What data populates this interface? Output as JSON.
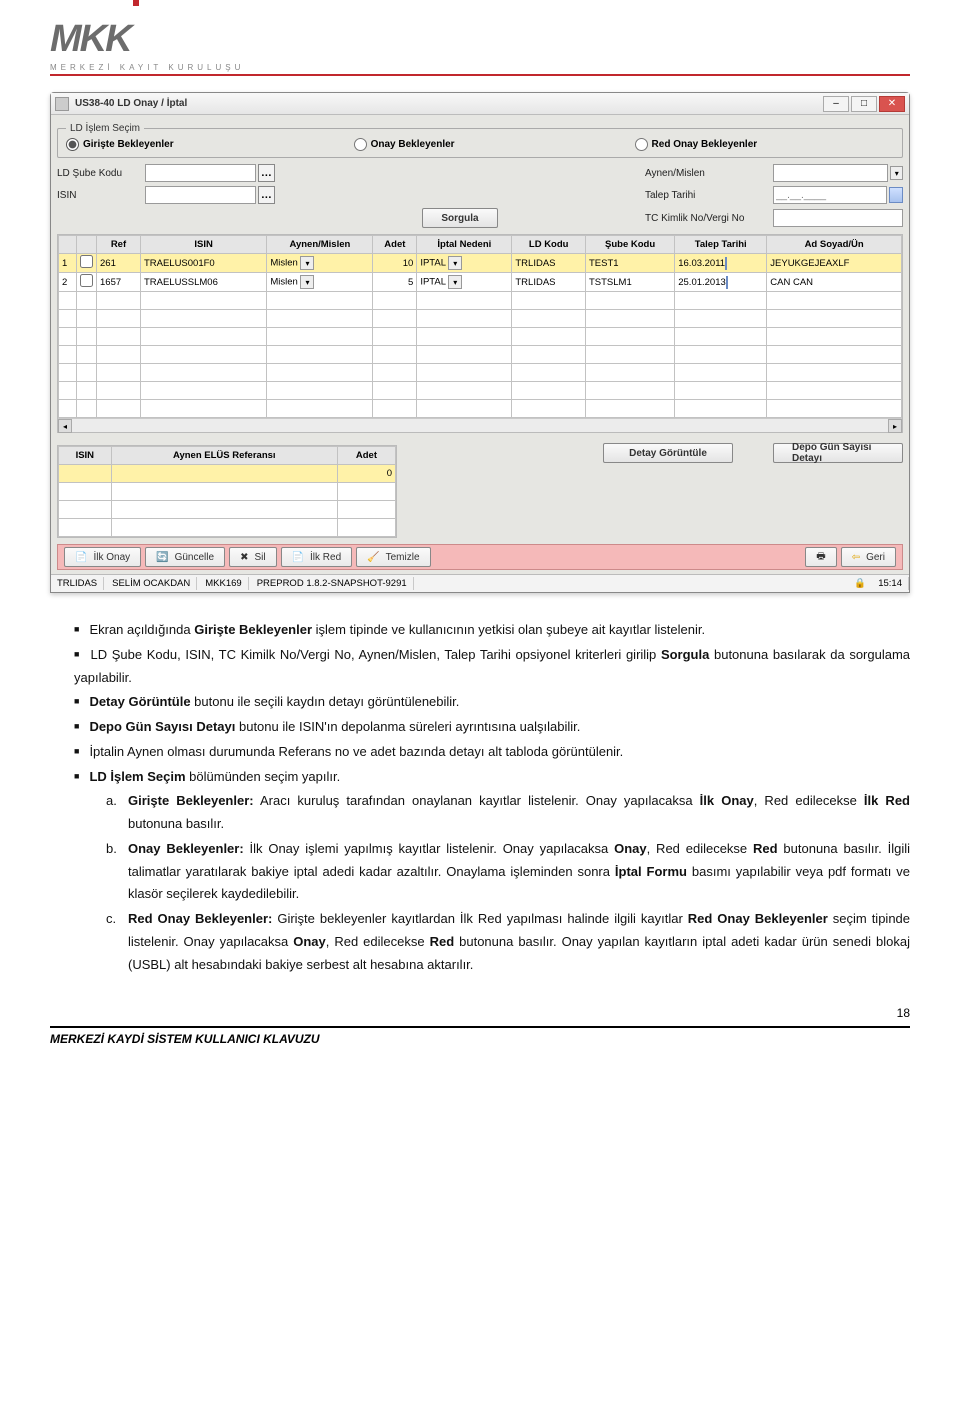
{
  "logo": {
    "letters": "MKK",
    "tagline": "MERKEZİ KAYIT KURULUŞU"
  },
  "window": {
    "title": "US38-40 LD Onay / İptal",
    "group_legend": "LD İşlem Seçim",
    "radios": {
      "giriste": "Girişte Bekleyenler",
      "onay": "Onay Bekleyenler",
      "redonay": "Red Onay Bekleyenler"
    },
    "labels": {
      "ld_sube": "LD Şube Kodu",
      "isin": "ISIN",
      "aynen": "Aynen/Mislen",
      "talep": "Talep Tarihi",
      "tc": "TC Kimlik No/Vergi No",
      "sorgula": "Sorgula",
      "talep_placeholder": "__.__.____"
    },
    "table1": {
      "headers": [
        "#",
        "",
        "Ref",
        "ISIN",
        "Aynen/Mislen",
        "Adet",
        "İptal Nedeni",
        "LD Kodu",
        "Şube Kodu",
        "Talep Tarihi",
        "Ad Soyad/Ün"
      ],
      "rows": [
        {
          "n": "1",
          "ref": "261",
          "isin": "TRAELUS001F0",
          "am": "Mislen",
          "adet": "10",
          "iptal": "IPTAL",
          "ld": "TRLIDAS",
          "sube": "TEST1",
          "tarih": "16.03.2011",
          "ad": "JEYUKGEJEAXLF",
          "hl": true
        },
        {
          "n": "2",
          "ref": "1657",
          "isin": "TRAELUSSLM06",
          "am": "Mislen",
          "adet": "5",
          "iptal": "IPTAL",
          "ld": "TRLIDAS",
          "sube": "TSTSLM1",
          "tarih": "25.01.2013",
          "ad": "CAN CAN",
          "hl": false
        }
      ]
    },
    "table2": {
      "headers": [
        "ISIN",
        "Aynen ELÜS Referansı",
        "Adet"
      ],
      "row_adet": "0"
    },
    "buttons": {
      "detay": "Detay Görüntüle",
      "depo": "Depo Gün Sayısı Detayı",
      "ilk_onay": "İlk Onay",
      "guncelle": "Güncelle",
      "sil": "Sil",
      "ilk_red": "İlk Red",
      "temizle": "Temizle",
      "geri": "Geri"
    },
    "status": {
      "s1": "TRLIDAS",
      "s2": "SELİM OCAKDAN",
      "s3": "MKK169",
      "s4": "PREPROD 1.8.2-SNAPSHOT-9291",
      "time": "15:14"
    }
  },
  "doc": {
    "b1_a": "Ekran açıldığında ",
    "b1_b": "Girişte Bekleyenler",
    "b1_c": " işlem tipinde ve kullanıcının yetkisi olan şubeye ait kayıtlar listelenir.",
    "b2_a": "LD Şube Kodu, ISIN, TC Kimilk No/Vergi No, Aynen/Mislen, Talep Tarihi opsiyonel kriterleri girilip ",
    "b2_b": "Sorgula",
    "b2_c": " butonuna basılarak da sorgulama yapılabilir.",
    "b3_a": "Detay Görüntüle",
    "b3_b": " butonu ile seçili kaydın detayı görüntülenebilir.",
    "b4_a": "Depo Gün Sayısı Detayı",
    "b4_b": " butonu ile ISIN'ın depolanma süreleri ayrıntısına ualşılabilir.",
    "b5": "İptalin Aynen olması durumunda Referans no ve adet bazında detayı alt tabloda görüntülenir.",
    "b6_a": "LD İşlem Seçim",
    "b6_b": " bölümünden seçim yapılır.",
    "la": "a.",
    "la_t1": "Girişte Bekleyenler:",
    "la_t2": " Aracı kuruluş tarafından onaylanan kayıtlar listelenir. Onay yapılacaksa ",
    "la_t3": "İlk Onay",
    "la_t4": ", Red edilecekse ",
    "la_t5": "İlk Red",
    "la_t6": " butonuna basılır.",
    "lb": "b.",
    "lb_t1": "Onay Bekleyenler:",
    "lb_t2": " İlk Onay işlemi yapılmış kayıtlar listelenir. Onay yapılacaksa ",
    "lb_t3": "Onay",
    "lb_t4": ", Red edilecekse ",
    "lb_t5": "Red",
    "lb_t6": " butonuna basılır. İlgili talimatlar yaratılarak bakiye iptal adedi kadar azaltılır. Onaylama işleminden sonra ",
    "lb_t7": "İptal Formu",
    "lb_t8": " basımı yapılabilir veya  pdf formatı ve klasör seçilerek kaydedilebilir.",
    "lc": "c.",
    "lc_t1": "Red Onay Bekleyenler:",
    "lc_t2": " Girişte bekleyenler kayıtlardan İlk Red yapılması halinde ilgili kayıtlar ",
    "lc_t3": "Red Onay Bekleyenler",
    "lc_t4": " seçim tipinde listelenir. Onay yapılacaksa ",
    "lc_t5": "Onay",
    "lc_t6": ", Red edilecekse ",
    "lc_t7": "Red",
    "lc_t8": " butonuna basılır. Onay yapılan kayıtların iptal adeti kadar ürün senedi blokaj (USBL) alt hesabındaki bakiye serbest alt hesabına aktarılır."
  },
  "page_number": "18",
  "footer": "MERKEZİ KAYDİ SİSTEM KULLANICI KLAVUZU"
}
